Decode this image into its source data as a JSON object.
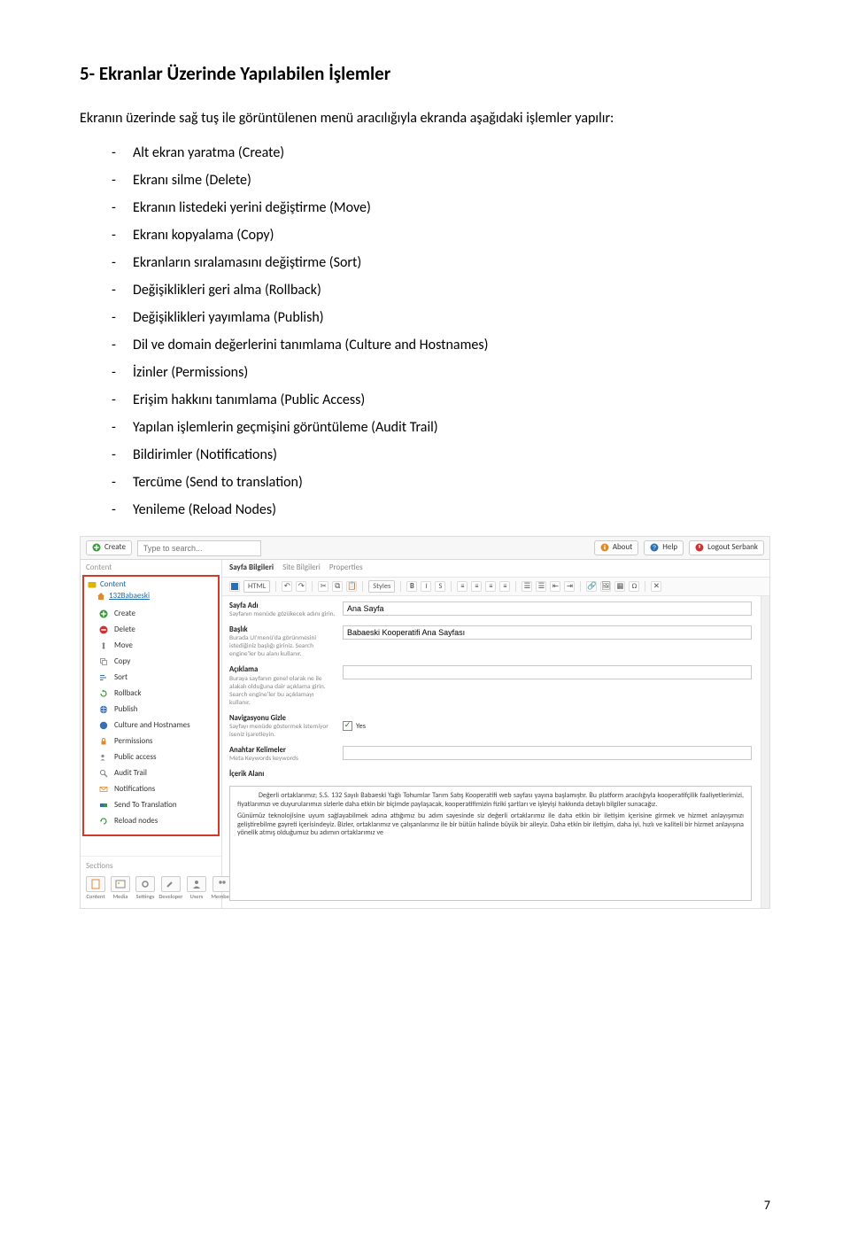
{
  "title": "5- Ekranlar Üzerinde Yapılabilen İşlemler",
  "intro": "Ekranın üzerinde sağ tuş ile görüntülenen menü aracılığıyla ekranda aşağıdaki işlemler yapılır:",
  "list_items": [
    "Alt ekran yaratma (Create)",
    "Ekranı silme (Delete)",
    "Ekranın listedeki yerini değiştirme (Move)",
    "Ekranı kopyalama (Copy)",
    "Ekranların sıralamasını değiştirme (Sort)",
    "Değişiklikleri geri alma (Rollback)",
    "Değişiklikleri yayımlama (Publish)",
    "Dil ve domain değerlerini tanımlama (Culture and Hostnames)",
    "İzinler (Permissions)",
    "Erişim hakkını tanımlama (Public Access)",
    "Yapılan işlemlerin geçmişini görüntüleme (Audit Trail)",
    "Bildirimler (Notifications)",
    "Tercüme (Send to translation)",
    "Yenileme (Reload Nodes)"
  ],
  "shot": {
    "topbar": {
      "create_label": "Create",
      "search_placeholder": "Type to search...",
      "about_label": "About",
      "help_label": "Help",
      "logout_label": "Logout Serbank"
    },
    "left": {
      "section": "Content",
      "root": "Content",
      "node": "132Babaeski",
      "ctx": [
        "Create",
        "Delete",
        "Move",
        "Copy",
        "Sort",
        "Rollback",
        "Publish",
        "Culture and Hostnames",
        "Permissions",
        "Public access",
        "Audit Trail",
        "Notifications",
        "Send To Translation",
        "Reload nodes"
      ],
      "sections_label": "Sections",
      "sections": [
        "Content",
        "Media",
        "Settings",
        "Developer",
        "Users",
        "Members"
      ]
    },
    "main": {
      "tabs": [
        "Sayfa Bilgileri",
        "Site Bilgileri",
        "Properties"
      ],
      "rte": {
        "html_ico": "HTML",
        "styles_label": "Styles"
      },
      "fields": {
        "sayfa_adi": {
          "label": "Sayfa Adı",
          "help": "Sayfanın menüde gözükecek adını girin.",
          "value": "Ana Sayfa"
        },
        "baslik": {
          "label": "Başlık",
          "help": "Burada UI'menü'da görünmesini istediğiniz başlığı giriniz. Search engine'ler bu alanı kullanır.",
          "value": "Babaeski Kooperatifi Ana Sayfası"
        },
        "aciklama": {
          "label": "Açıklama",
          "help": "Buraya sayfanın genel olarak ne ile alakalı olduğuna dair açıklama girin. Search engine'ler bu açıklamayı kullanır.",
          "value": ""
        },
        "nav_gizle": {
          "label": "Navigasyonu Gizle",
          "help": "Sayfayı menüde göstermek istemiyor iseniz işaretleyin.",
          "checkbox_label": "Yes"
        },
        "anahtar": {
          "label": "Anahtar Kelimeler",
          "help": "Meta Keywords keywords"
        },
        "icerik": {
          "label": "İçerik Alanı"
        }
      },
      "content_p1": "Değerli ortaklarımız; S.S. 132 Sayılı Babaeski Yağlı Tohumlar Tarım Satış Kooperatifi web sayfası yayına başlamıştır. Bu platform aracılığıyla kooperatifçilik faaliyetlerimizi, fiyatlarımızı ve duyurularımızı sizlerle daha etkin bir biçimde paylaşacak, kooperatifimizin fiziki şartları ve işleyişi hakkında detaylı bilgiler sunacağız.",
      "content_p2": "Günümüz teknolojisine uyum sağlayabilmek adına attığımız bu adım sayesinde siz değerli ortaklarımız ile daha etkin bir iletişim içerisine girmek ve hizmet anlayışımızı geliştirebilme gayreti içerisindeyiz. Bizler, ortaklarımız ve çalışanlarımız ile bir bütün halinde büyük bir aileyiz. Daha etkin bir iletişim, daha iyi, hızlı ve kaliteli bir hizmet anlayışına yönelik atmış olduğumuz bu adımın ortaklarımız ve"
    }
  },
  "page_number": "7"
}
